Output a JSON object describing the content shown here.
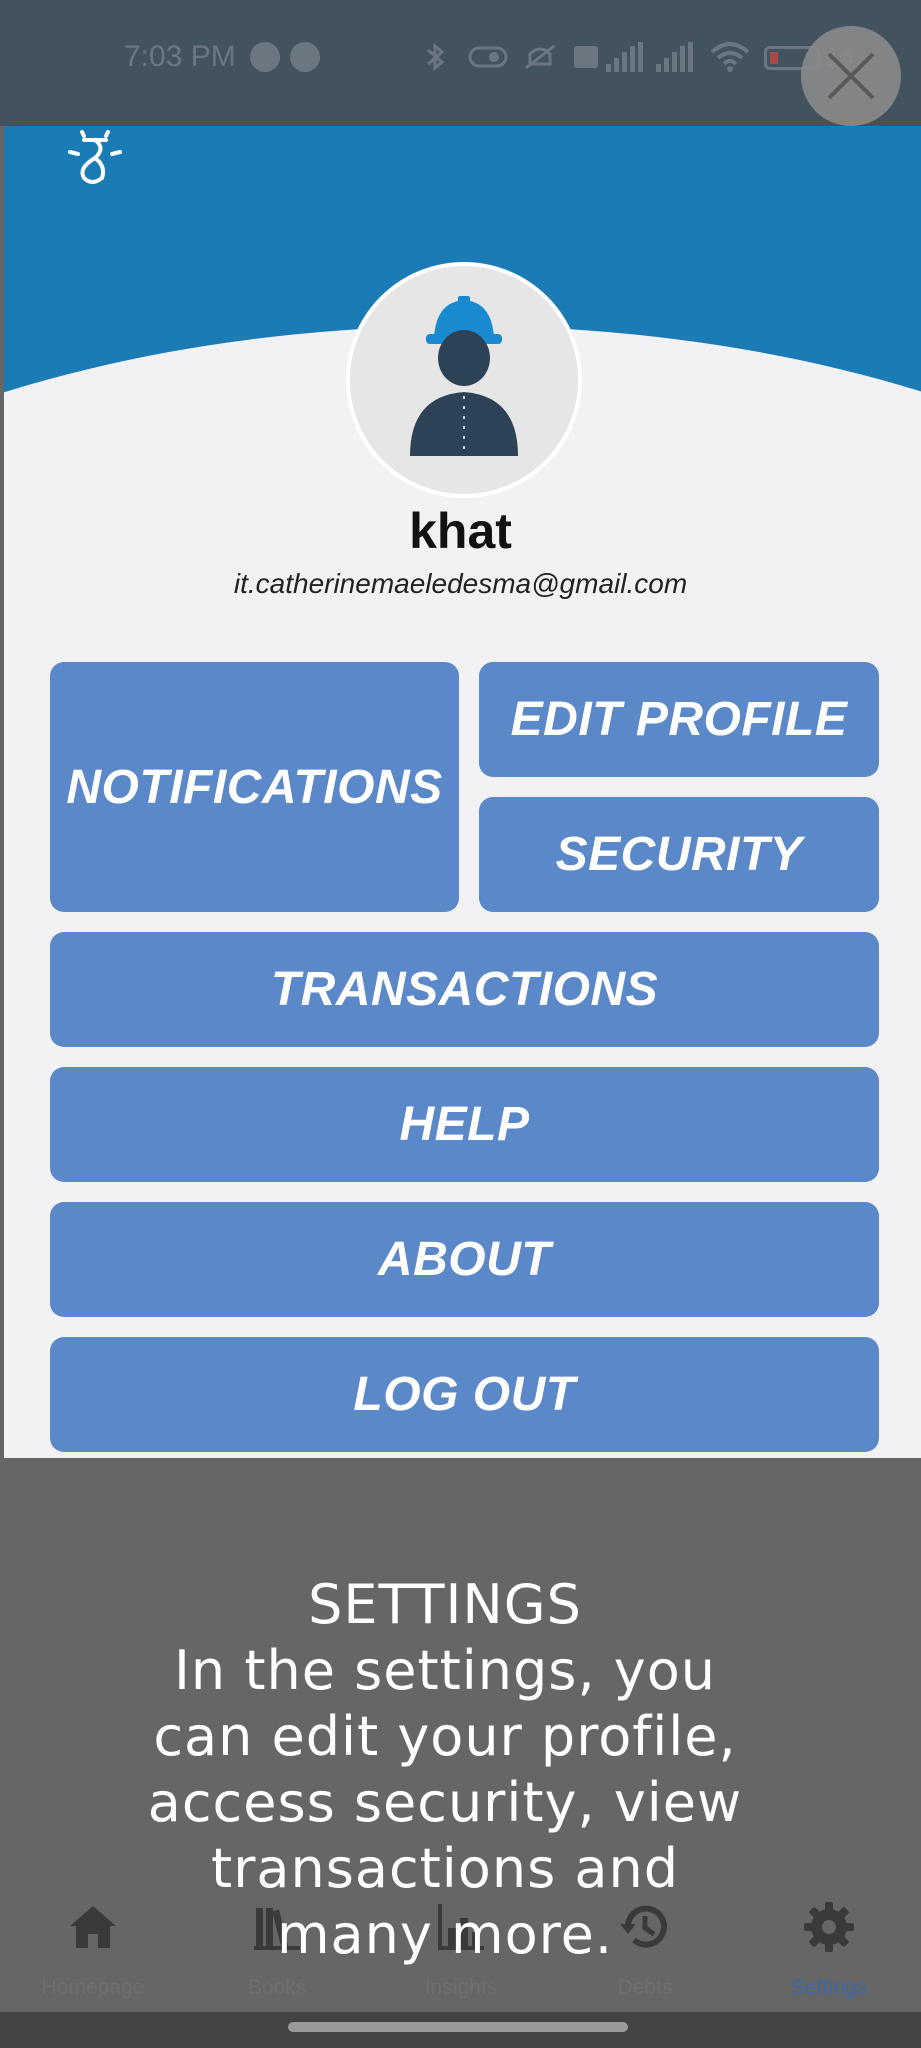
{
  "status_bar": {
    "time": "7:03 PM",
    "icons": [
      "messenger-icon",
      "app-icon",
      "bluetooth-icon",
      "vibrate-icon",
      "mute-icon",
      "volte-icon",
      "signal-icon",
      "signal-icon",
      "wifi-icon",
      "battery-icon"
    ],
    "battery_level": "14"
  },
  "header": {
    "logo": "app-logo-icon",
    "brand_color": "#1a7bb5"
  },
  "profile": {
    "name": "khat",
    "email": "it.catherinemaeledesma@gmail.com"
  },
  "menu": {
    "notifications": "NOTIFICATIONS",
    "edit_profile": "EDIT PROFILE",
    "security": "SECURITY",
    "transactions": "TRANSACTIONS",
    "help": "HELP",
    "about": "ABOUT",
    "log_out": "LOG OUT",
    "tile_color": "#5b88c8"
  },
  "tutorial": {
    "line1": "SETTINGS",
    "line2": "In the settings,  you",
    "line3": "can edit your profile,",
    "line4": "access security, view",
    "line5": "transactions and",
    "line6": "many more."
  },
  "nav": {
    "items": [
      {
        "label": "Homepage",
        "icon": "home-icon"
      },
      {
        "label": "Books",
        "icon": "books-icon"
      },
      {
        "label": "Insights",
        "icon": "insights-icon"
      },
      {
        "label": "Debts",
        "icon": "history-icon"
      },
      {
        "label": "Settings",
        "icon": "gear-icon"
      }
    ],
    "active": "Settings"
  }
}
